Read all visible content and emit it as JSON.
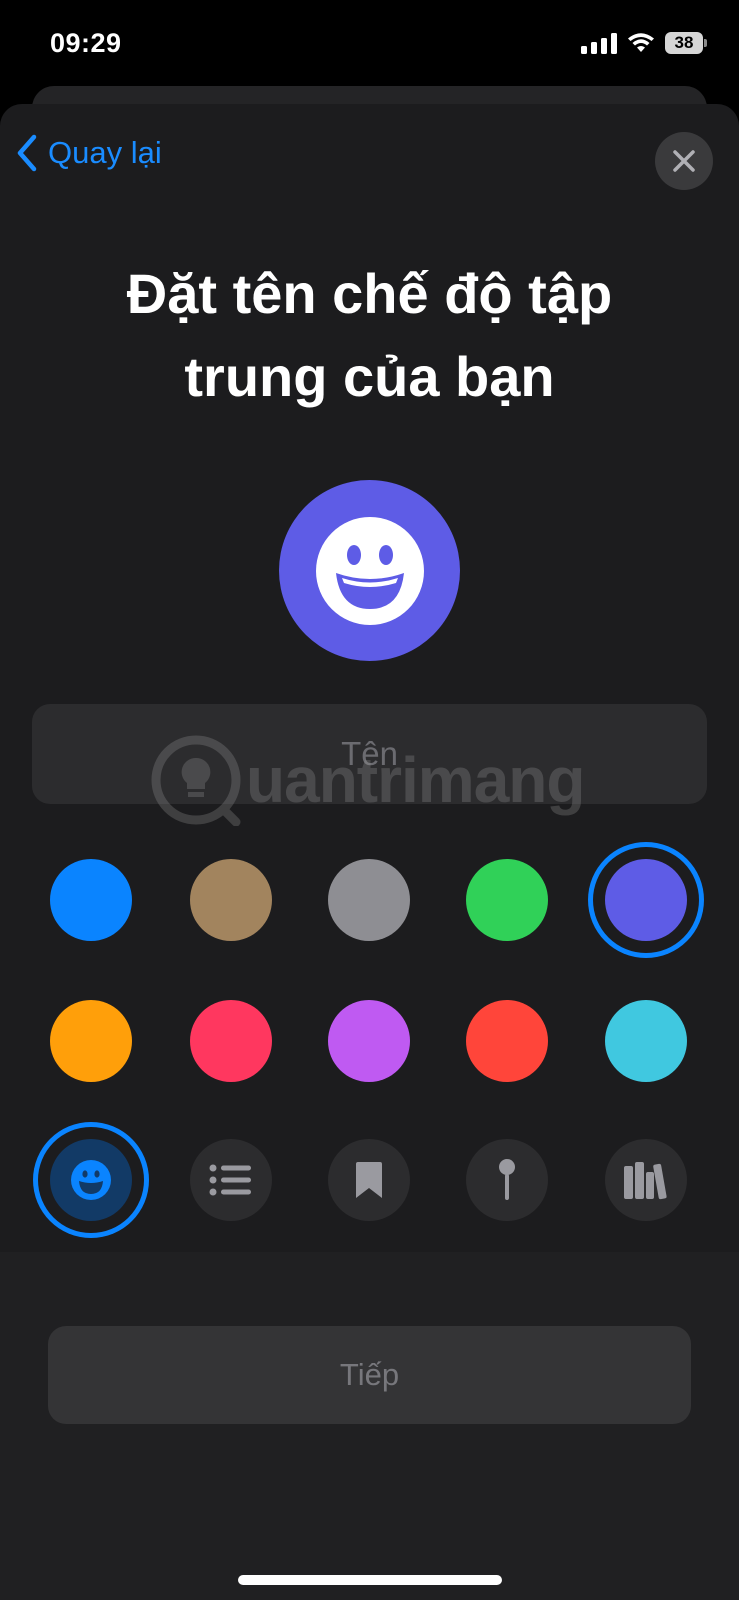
{
  "status_bar": {
    "time": "09:29",
    "battery": "38"
  },
  "nav": {
    "back_label": "Quay lại",
    "close_icon": "xmark-icon",
    "back_icon": "chevron-left-icon"
  },
  "title": {
    "line1": "Đặt tên chế độ tập",
    "line2": "trung của bạn"
  },
  "focus_icon": {
    "name": "smiley-face-icon",
    "color": "#5e5ce6"
  },
  "name_input": {
    "placeholder": "Tên",
    "value": ""
  },
  "watermark": {
    "text": "uantrimang"
  },
  "colors": [
    {
      "name": "blue",
      "hex": "#0a84ff",
      "selected": false
    },
    {
      "name": "tan",
      "hex": "#a2845e",
      "selected": false
    },
    {
      "name": "gray",
      "hex": "#8e8e93",
      "selected": false
    },
    {
      "name": "green",
      "hex": "#30d158",
      "selected": false
    },
    {
      "name": "indigo",
      "hex": "#5e5ce6",
      "selected": true
    },
    {
      "name": "orange",
      "hex": "#ff9f0a",
      "selected": false
    },
    {
      "name": "pink",
      "hex": "#ff375f",
      "selected": false
    },
    {
      "name": "purple",
      "hex": "#bf5af2",
      "selected": false
    },
    {
      "name": "red",
      "hex": "#ff453a",
      "selected": false
    },
    {
      "name": "cyan",
      "hex": "#40c8e0",
      "selected": false
    }
  ],
  "icons": [
    {
      "name": "smiley-face-icon",
      "selected": true
    },
    {
      "name": "list-bullet-icon",
      "selected": false
    },
    {
      "name": "bookmark-icon",
      "selected": false
    },
    {
      "name": "pin-icon",
      "selected": false
    },
    {
      "name": "books-icon",
      "selected": false
    }
  ],
  "footer": {
    "next_label": "Tiếp"
  },
  "accent_color": "#0a84ff"
}
